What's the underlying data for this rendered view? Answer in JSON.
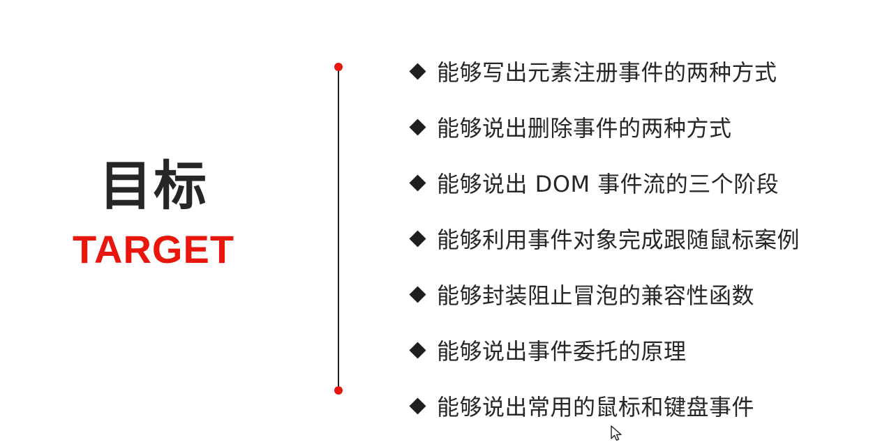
{
  "slide": {
    "title_cn": "目标",
    "title_en": "TARGET",
    "goals": [
      "能够写出元素注册事件的两种方式",
      "能够说出删除事件的两种方式",
      "能够说出 DOM 事件流的三个阶段",
      "能够利用事件对象完成跟随鼠标案例",
      "能够封装阻止冒泡的兼容性函数",
      "能够说出事件委托的原理",
      "能够说出常用的鼠标和键盘事件"
    ],
    "bullet_icon": "diamond-icon",
    "cursor_icon": "mouse-pointer-icon",
    "colors": {
      "accent": "#e8160c",
      "text": "#262626",
      "line": "#1f1f1f",
      "background": "#ffffff"
    }
  }
}
